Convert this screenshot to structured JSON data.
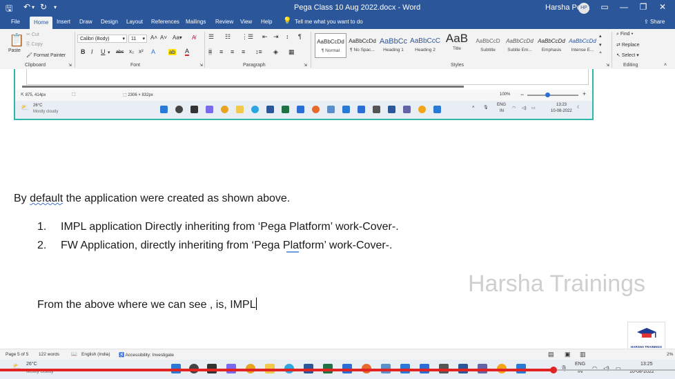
{
  "titlebar": {
    "doc_title": "Pega Class 10 Aug 2022.docx  -  Word",
    "user_name": "Harsha Pega",
    "user_initials": "HP"
  },
  "tabs": [
    "File",
    "Home",
    "Insert",
    "Draw",
    "Design",
    "Layout",
    "References",
    "Mailings",
    "Review",
    "View",
    "Help"
  ],
  "tell_me": "Tell me what you want to do",
  "share": "Share",
  "ribbon": {
    "clipboard": {
      "paste": "Paste",
      "cut": "Cut",
      "copy": "Copy",
      "format_painter": "Format Painter",
      "label": "Clipboard"
    },
    "font": {
      "name": "Calibri (Body)",
      "size": "11",
      "label": "Font"
    },
    "paragraph_label": "Paragraph",
    "styles": [
      {
        "preview": "AaBbCcDd",
        "name": "¶ Normal"
      },
      {
        "preview": "AaBbCcDd",
        "name": "¶ No Spac..."
      },
      {
        "preview": "AaBbCc",
        "name": "Heading 1"
      },
      {
        "preview": "AaBbCcC",
        "name": "Heading 2"
      },
      {
        "preview": "AaB",
        "name": "Title"
      },
      {
        "preview": "AaBbCcD",
        "name": "Subtitle"
      },
      {
        "preview": "AaBbCcDd",
        "name": "Subtle Em..."
      },
      {
        "preview": "AaBbCcDd",
        "name": "Emphasis"
      },
      {
        "preview": "AaBbCcDd",
        "name": "Intense E..."
      }
    ],
    "styles_label": "Styles",
    "editing": {
      "find": "Find",
      "replace": "Replace",
      "select": "Select",
      "label": "Editing"
    }
  },
  "embedded": {
    "cursor_pos": "875, 414px",
    "dims": "2306 × 832px",
    "zoom": "100%",
    "weather_temp": "26°C",
    "weather_desc": "Mostly cloudy",
    "lang": "ENG",
    "region": "IN",
    "time": "13:23",
    "date": "10-08-2022"
  },
  "doc": {
    "para1_pre": "By ",
    "para1_sq": "default",
    "para1_post": " the application were created as shown above.",
    "items": [
      {
        "num": "1.",
        "text": "IMPL application Directly inheriting from ‘Pega Platform’ work-Cover-."
      },
      {
        "num": "2.",
        "text": "FW Application, directly inheriting from  ‘Pega Platform’ work-Cover-."
      }
    ],
    "para2": "From the above where we can see , is, IMPL"
  },
  "watermark": "Harsha Trainings",
  "logo_text": "HARSHA TRAININGS",
  "status": {
    "page": "Page 5 of 5",
    "words": "122 words",
    "language": "English (India)",
    "accessibility": "Accessibility: Investigate",
    "zoom": "2%"
  },
  "taskbar": {
    "weather_temp": "26°C",
    "weather_desc": "Mostly cloudy",
    "lang": "ENG",
    "region": "IN",
    "time": "13:25",
    "date": "10-08-2022"
  },
  "video_progress": 0.82,
  "colors": {
    "word_blue": "#2b579a",
    "embed_border": "#2db7a8",
    "progress_red": "#e02424"
  }
}
